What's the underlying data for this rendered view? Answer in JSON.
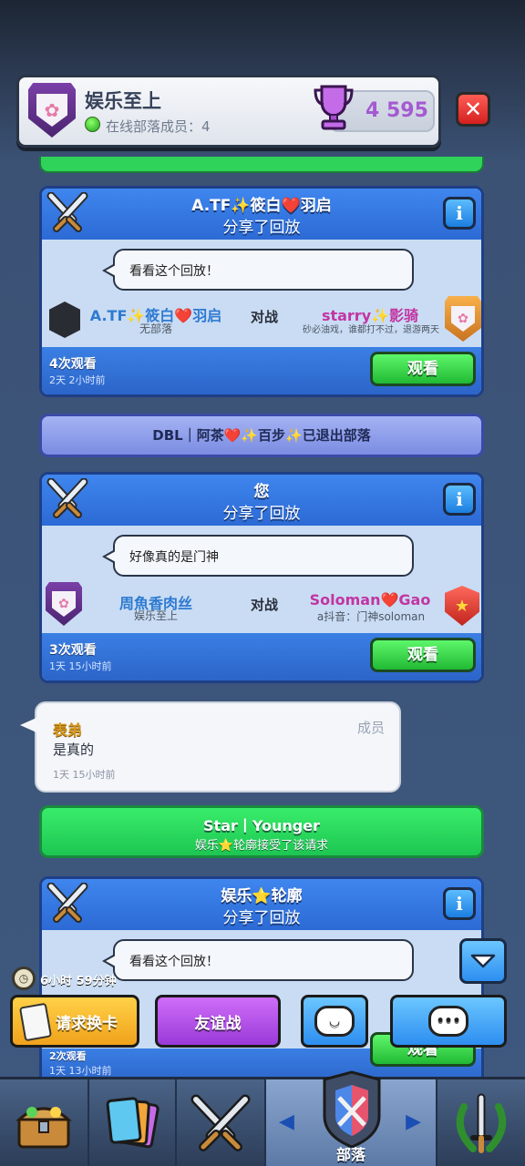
{
  "header": {
    "clan_name": "娱乐至上",
    "online_label": "在线部落成员：4",
    "trophies": "4 595"
  },
  "feed": {
    "system_left": "DBL｜阿茶❤️✨百步✨已退出部落",
    "replays": [
      {
        "sharer": "A.TF✨筱白❤️羽启",
        "shared_text": "分享了回放",
        "message": "看看这个回放！",
        "left_player": "A.TF✨筱白❤️羽启",
        "left_clan": "无部落",
        "vs": "对战",
        "right_player": "starry✨影骑",
        "right_clan": "砂必油戏，谁都打不过，退游两天",
        "views": "4次观看",
        "ago": "2天 2小时前",
        "watch": "观看"
      },
      {
        "sharer": "您",
        "shared_text": "分享了回放",
        "message": "好像真的是门神",
        "left_player": "周魚香肉丝",
        "left_clan": "娱乐至上",
        "vs": "对战",
        "right_player": "Soloman❤️Gao",
        "right_clan": "a抖音：门神soloman",
        "views": "3次观看",
        "ago": "1天 15小时前",
        "watch": "观看"
      },
      {
        "sharer": "娱乐⭐轮廓",
        "shared_text": "分享了回放",
        "message": "看看这个回放！",
        "views": "2次观看",
        "ago": "1天 13小时前",
        "watch": "观看"
      }
    ],
    "chat": {
      "author": "表弟",
      "role": "成员",
      "text": "是真的",
      "time": "1天 15小时前"
    },
    "accepted": {
      "title": "Star丨Younger",
      "subtitle": "娱乐⭐轮廓接受了该请求"
    }
  },
  "actions": {
    "timer": "6小时 59分钟",
    "request_card": "请求换卡",
    "friendly_battle": "友谊战"
  },
  "nav": {
    "active_label": "部落"
  },
  "colors": {
    "accent_blue": "#2c6ad5",
    "watch_green": "#21b934",
    "close_red": "#d41f1f"
  }
}
